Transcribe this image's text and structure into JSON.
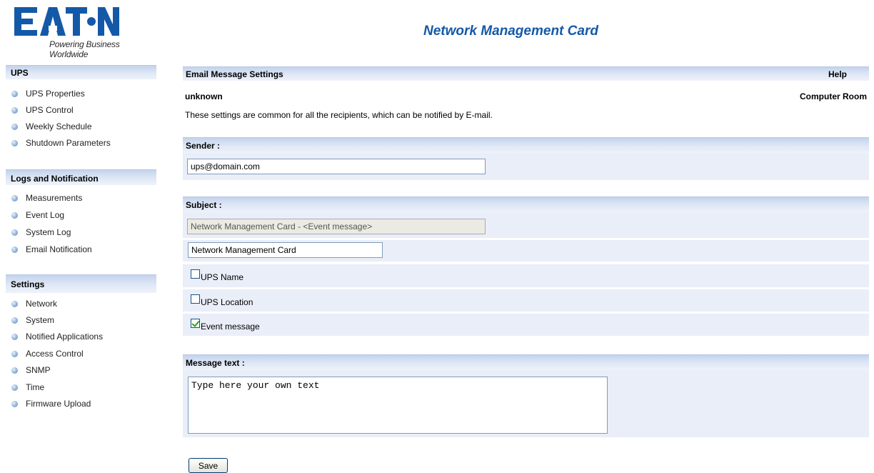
{
  "brand": {
    "logo_text": "EATON",
    "tagline": "Powering Business Worldwide",
    "color": "#1459a8"
  },
  "app_title": "Network Management Card",
  "sidebar": {
    "sections": [
      {
        "title": "UPS",
        "items": [
          "UPS Properties",
          "UPS Control",
          "Weekly Schedule",
          "Shutdown Parameters"
        ]
      },
      {
        "title": "Logs and Notification",
        "items": [
          "Measurements",
          "Event Log",
          "System Log",
          "Email Notification"
        ]
      },
      {
        "title": "Settings",
        "items": [
          "Network",
          "System",
          "Notified Applications",
          "Access Control",
          "SNMP",
          "Time",
          "Firmware Upload"
        ]
      }
    ]
  },
  "main": {
    "header": {
      "title": "Email Message Settings",
      "help": "Help"
    },
    "ups_name": "unknown",
    "location": "Computer Room",
    "description": "These settings are common for all the recipients, which can be notified by E-mail.",
    "sender": {
      "label": "Sender :",
      "value": "ups@domain.com"
    },
    "subject": {
      "label": "Subject :",
      "preview": "Network Management Card - <Event message>",
      "value": "Network Management Card",
      "options": [
        {
          "label": "UPS Name",
          "checked": false
        },
        {
          "label": "UPS Location",
          "checked": false
        },
        {
          "label": "Event message",
          "checked": true
        }
      ]
    },
    "message": {
      "label": "Message text :",
      "value": "Type here your own text"
    },
    "save_label": "Save"
  }
}
